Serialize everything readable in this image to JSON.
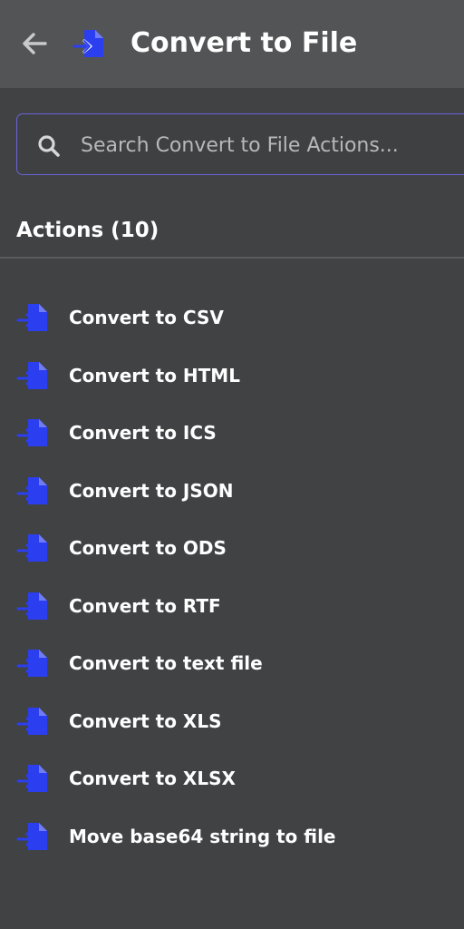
{
  "header": {
    "back_icon": "arrow-left-icon",
    "app_icon": "file-import-icon",
    "title": "Convert to File"
  },
  "search": {
    "icon": "search-icon",
    "placeholder": "Search Convert to File Actions...",
    "value": ""
  },
  "actions": {
    "heading": "Actions (10)",
    "items": [
      {
        "label": "Convert to CSV",
        "icon": "file-import-icon"
      },
      {
        "label": "Convert to HTML",
        "icon": "file-import-icon"
      },
      {
        "label": "Convert to ICS",
        "icon": "file-import-icon"
      },
      {
        "label": "Convert to JSON",
        "icon": "file-import-icon"
      },
      {
        "label": "Convert to ODS",
        "icon": "file-import-icon"
      },
      {
        "label": "Convert to RTF",
        "icon": "file-import-icon"
      },
      {
        "label": "Convert to text file",
        "icon": "file-import-icon"
      },
      {
        "label": "Convert to XLS",
        "icon": "file-import-icon"
      },
      {
        "label": "Convert to XLSX",
        "icon": "file-import-icon"
      },
      {
        "label": "Move base64 string to file",
        "icon": "file-import-icon"
      }
    ]
  },
  "colors": {
    "background": "#414244",
    "header_background": "#535456",
    "accent_blue": "#2b3ff0",
    "search_border": "#6a63d8",
    "text": "#ffffff",
    "placeholder": "#b7b8ba"
  }
}
